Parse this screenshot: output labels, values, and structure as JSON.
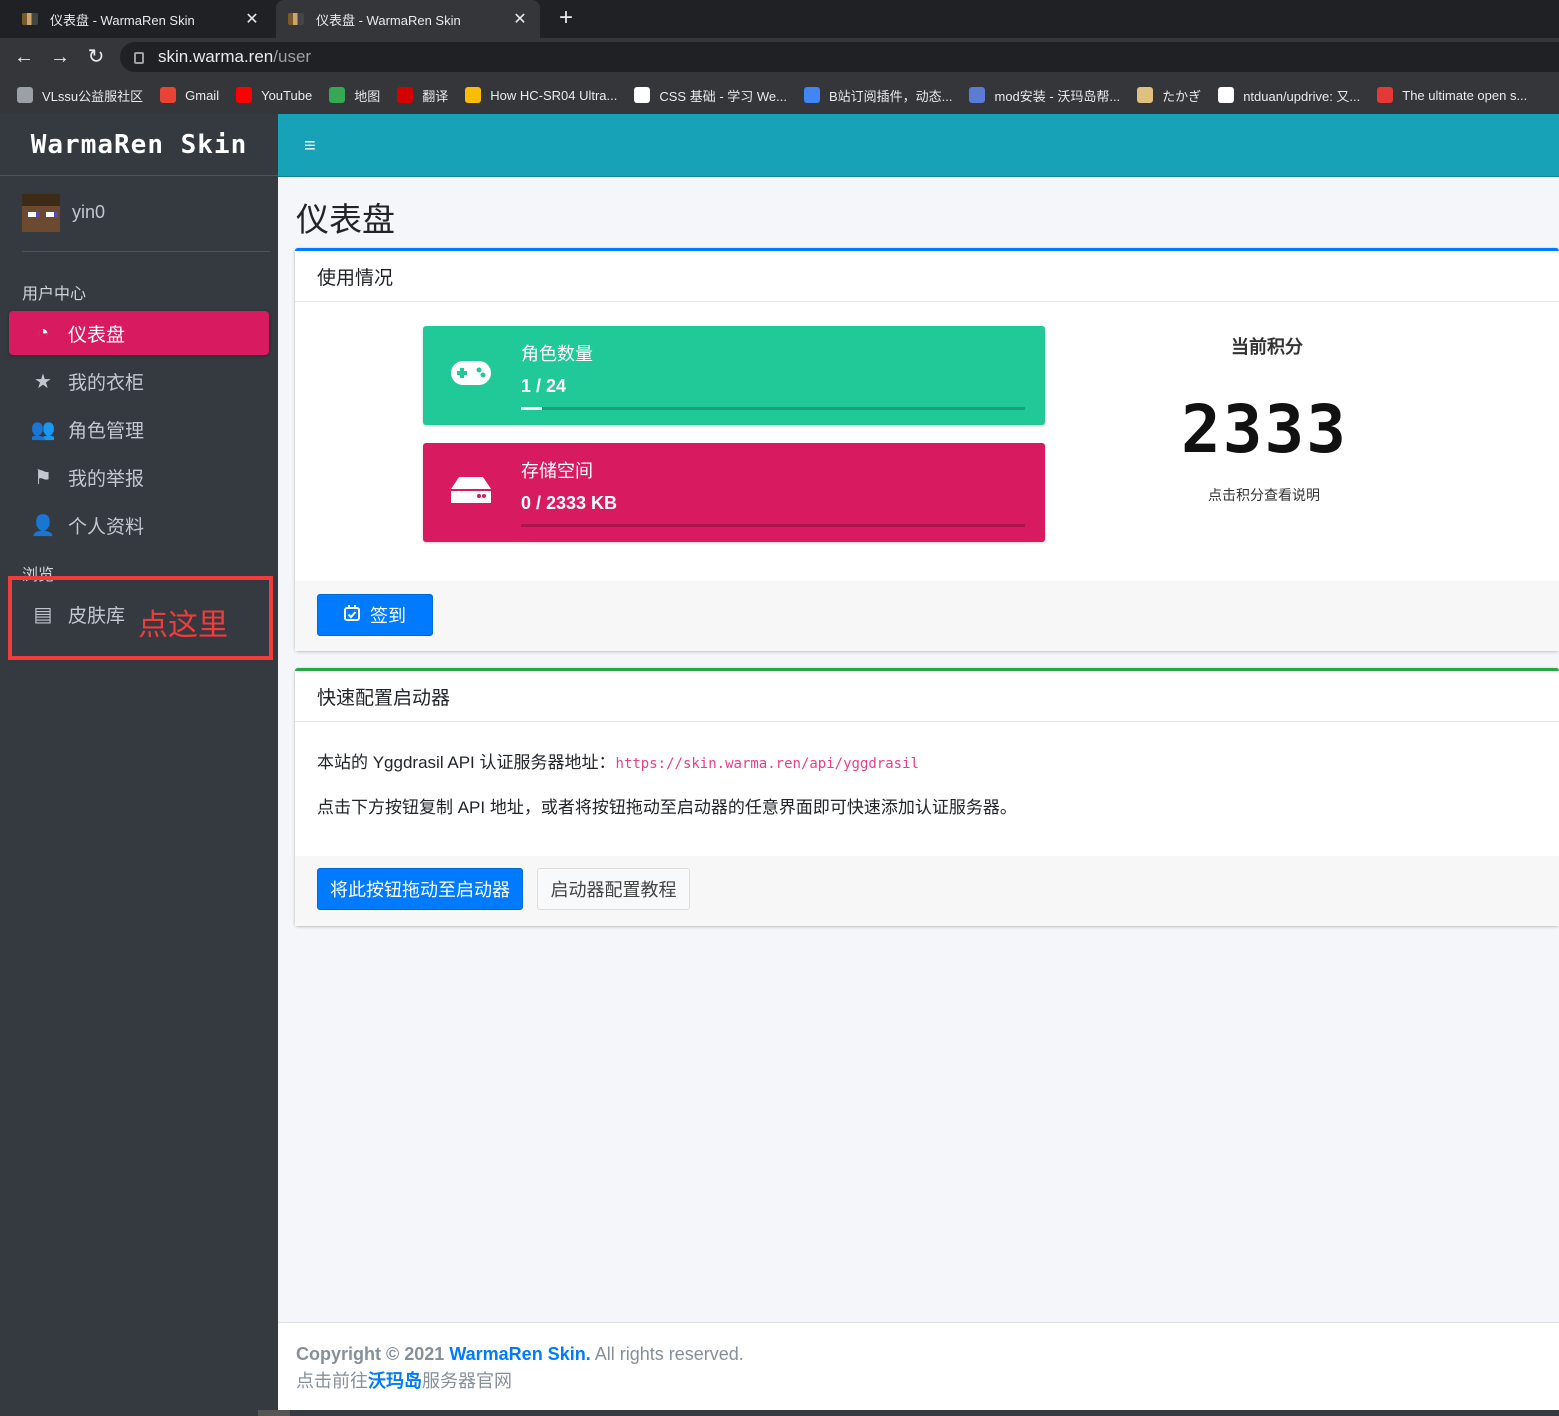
{
  "browser": {
    "tabs": [
      {
        "title": "仪表盘 - WarmaRen Skin"
      },
      {
        "title": "仪表盘 - WarmaRen Skin"
      }
    ],
    "close_glyph": "✕",
    "new_tab_glyph": "+",
    "url_host": "skin.warma.ren",
    "url_path": "/user",
    "nav": {
      "back": "←",
      "forward": "→",
      "reload": "↻"
    },
    "bookmarks": [
      {
        "label": "VLssu公益服社区",
        "color": "#9aa0a6"
      },
      {
        "label": "Gmail",
        "color": "#ea4335"
      },
      {
        "label": "YouTube",
        "color": "#ff0000"
      },
      {
        "label": "地图",
        "color": "#34a853"
      },
      {
        "label": "翻译",
        "color": "#d50000"
      },
      {
        "label": "How HC-SR04 Ultra...",
        "color": "#fbbc05"
      },
      {
        "label": "CSS 基础 - 学习 We...",
        "color": "#ffffff"
      },
      {
        "label": "B站订阅插件，动态...",
        "color": "#4285f4"
      },
      {
        "label": "mod安装 - 沃玛岛帮...",
        "color": "#5b7bd5"
      },
      {
        "label": "たかぎ",
        "color": "#e0c080"
      },
      {
        "label": "ntduan/updrive: 又...",
        "color": "#ffffff"
      },
      {
        "label": "The ultimate open s...",
        "color": "#e53935"
      }
    ]
  },
  "sidebar": {
    "brand": "WarmaRen Skin",
    "username": "yin0",
    "header_user": "用户中心",
    "header_browse": "浏览",
    "items": [
      {
        "label": "仪表盘",
        "icon": "◔"
      },
      {
        "label": "我的衣柜",
        "icon": "★"
      },
      {
        "label": "角色管理",
        "icon": "👥"
      },
      {
        "label": "我的举报",
        "icon": "⚑"
      },
      {
        "label": "个人资料",
        "icon": "👤"
      },
      {
        "label": "皮肤库",
        "icon": "▤"
      }
    ],
    "annotation": "点这里"
  },
  "topnav": {
    "menu_icon": "≡"
  },
  "main": {
    "page_title": "仪表盘",
    "usage": {
      "title": "使用情况",
      "players": {
        "label": "角色数量",
        "value": "1 / 24",
        "progress": 0.042
      },
      "storage": {
        "label": "存储空间",
        "value": "0 / 2333 KB",
        "progress": 0
      },
      "score_title": "当前积分",
      "score": "2333",
      "score_hint": "点击积分查看说明",
      "checkin_label": "签到"
    },
    "launcher": {
      "title": "快速配置启动器",
      "api_prefix": "本站的 Yggdrasil API 认证服务器地址：",
      "api_url": "https://skin.warma.ren/api/yggdrasil",
      "description": "点击下方按钮复制 API 地址，或者将按钮拖动至启动器的任意界面即可快速添加认证服务器。",
      "drag_button": "将此按钮拖动至启动器",
      "tutorial_button": "启动器配置教程"
    }
  },
  "footer": {
    "copyright_prefix": "Copyright © 2021",
    "site_name": "WarmaRen Skin.",
    "rights": "All rights reserved.",
    "line2_prefix": "点击前往",
    "line2_link": "沃玛岛",
    "line2_suffix": "服务器官网"
  },
  "colors": {
    "sidebar_bg": "#343a40",
    "active_item": "#d81b60",
    "topnav": "#17a2b8",
    "players_box": "#20c997",
    "storage_box": "#d81b60",
    "primary": "#007bff",
    "annotation": "#f03c3c"
  }
}
